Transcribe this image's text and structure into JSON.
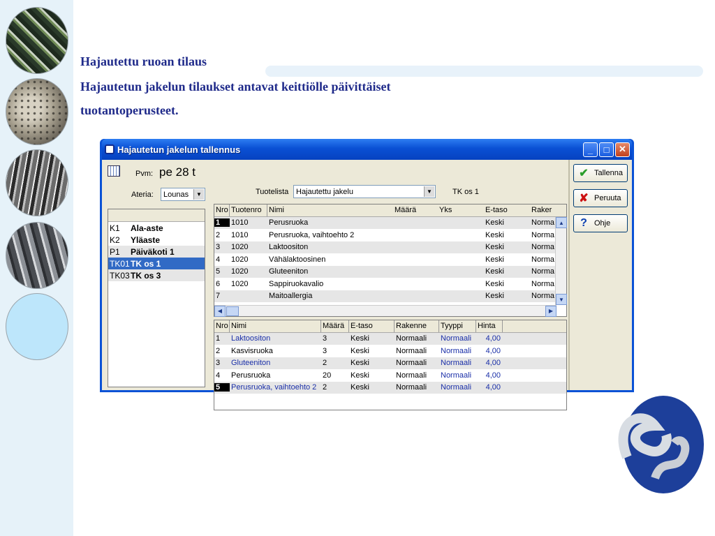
{
  "slide": {
    "title": "Hajautettu ruoan tilaus",
    "line2": "Hajautetun jakelun tilaukset antavat keittiölle päivittäiset",
    "line3": "tuotantoperusteet."
  },
  "window": {
    "title": "Hajautetun jakelun tallennus",
    "buttons": {
      "minimize": "_",
      "maximize": "□",
      "close": "✕"
    }
  },
  "left": {
    "pvm_label": "Pvm:",
    "pvm_value": "pe 28 t",
    "ateria_label": "Ateria:",
    "ateria_value": "Lounas",
    "sites": [
      {
        "code": "K1",
        "name": "Ala-aste"
      },
      {
        "code": "K2",
        "name": "Yläaste"
      },
      {
        "code": "P1",
        "name": "Päiväkoti 1"
      },
      {
        "code": "TK01",
        "name": "TK os 1"
      },
      {
        "code": "TK03",
        "name": "TK os 3"
      }
    ]
  },
  "top": {
    "tuotelista_label": "Tuotelista",
    "tuotelista_value": "Hajautettu jakelu",
    "tk_label": "TK os 1"
  },
  "grid1": {
    "headers": [
      "Nro",
      "Tuotenro",
      "Nimi",
      "Määrä",
      "Yks",
      "E-taso",
      "Raker"
    ],
    "rows": [
      {
        "nro": "1",
        "tuotenro": "1010",
        "nimi": "Perusruoka",
        "etaso": "Keski",
        "rakenne": "Norma"
      },
      {
        "nro": "2",
        "tuotenro": "1010",
        "nimi": "Perusruoka, vaihtoehto 2",
        "etaso": "Keski",
        "rakenne": "Norma"
      },
      {
        "nro": "3",
        "tuotenro": "1020",
        "nimi": "Laktoositon",
        "etaso": "Keski",
        "rakenne": "Norma"
      },
      {
        "nro": "4",
        "tuotenro": "1020",
        "nimi": "Vähälaktoosinen",
        "etaso": "Keski",
        "rakenne": "Norma"
      },
      {
        "nro": "5",
        "tuotenro": "1020",
        "nimi": "Gluteeniton",
        "etaso": "Keski",
        "rakenne": "Norma"
      },
      {
        "nro": "6",
        "tuotenro": "1020",
        "nimi": "Sappiruokavalio",
        "etaso": "Keski",
        "rakenne": "Norma"
      },
      {
        "nro": "7",
        "tuotenro": "",
        "nimi": "Maitoallergia",
        "etaso": "Keski",
        "rakenne": "Norma"
      }
    ]
  },
  "grid2": {
    "headers": [
      "Nro",
      "Nimi",
      "Määrä",
      "E-taso",
      "Rakenne",
      "Tyyppi",
      "Hinta"
    ],
    "rows": [
      {
        "nro": "1",
        "nimi": "Laktoositon",
        "maara": "3",
        "etaso": "Keski",
        "rakenne": "Normaali",
        "tyyppi": "Normaali",
        "hinta": "4,00",
        "blue": true
      },
      {
        "nro": "2",
        "nimi": "Kasvisruoka",
        "maara": "3",
        "etaso": "Keski",
        "rakenne": "Normaali",
        "tyyppi": "Normaali",
        "hinta": "4,00",
        "blue": false
      },
      {
        "nro": "3",
        "nimi": "Gluteeniton",
        "maara": "2",
        "etaso": "Keski",
        "rakenne": "Normaali",
        "tyyppi": "Normaali",
        "hinta": "4,00",
        "blue": true
      },
      {
        "nro": "4",
        "nimi": "Perusruoka",
        "maara": "20",
        "etaso": "Keski",
        "rakenne": "Normaali",
        "tyyppi": "Normaali",
        "hinta": "4,00",
        "blue": false
      },
      {
        "nro": "5",
        "nimi": "Perusruoka, vaihtoehto 2",
        "maara": "2",
        "etaso": "Keski",
        "rakenne": "Normaali",
        "tyyppi": "Normaali",
        "hinta": "4,00",
        "blue": true
      }
    ]
  },
  "actions": {
    "save": "Tallenna",
    "cancel": "Peruuta",
    "help": "Ohje"
  }
}
